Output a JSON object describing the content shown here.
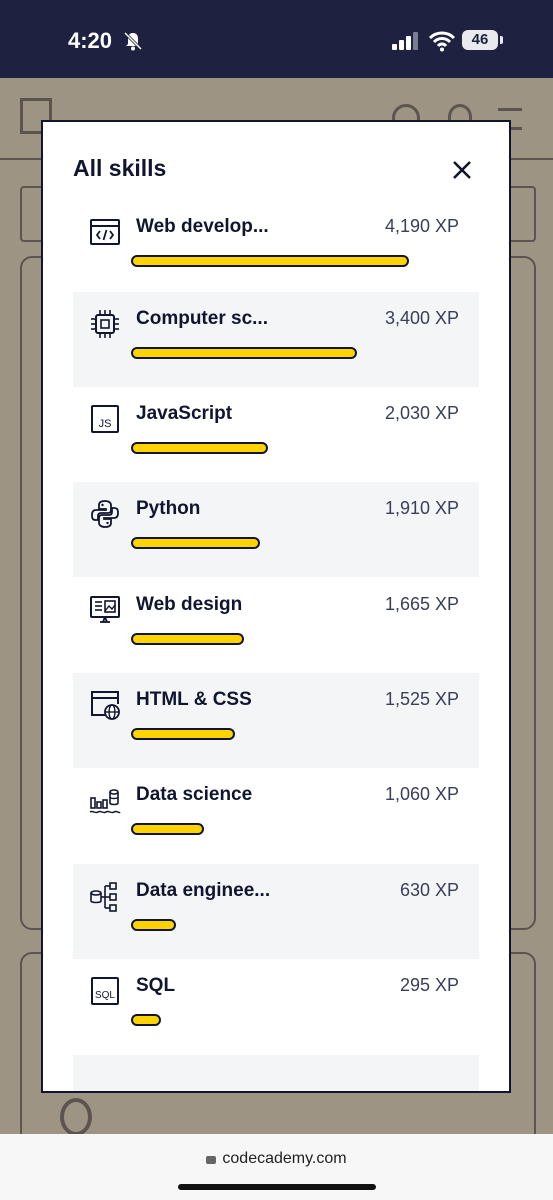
{
  "status_bar": {
    "time": "4:20",
    "battery": "46"
  },
  "modal": {
    "title": "All skills",
    "skills": [
      {
        "name": "Web develop...",
        "xp": "4,190 XP",
        "xp_value": 4190,
        "icon": "code-window-icon"
      },
      {
        "name": "Computer sc...",
        "xp": "3,400 XP",
        "xp_value": 3400,
        "icon": "chip-icon"
      },
      {
        "name": "JavaScript",
        "xp": "2,030 XP",
        "xp_value": 2030,
        "icon": "js-icon"
      },
      {
        "name": "Python",
        "xp": "1,910 XP",
        "xp_value": 1910,
        "icon": "python-icon"
      },
      {
        "name": "Web design",
        "xp": "1,665 XP",
        "xp_value": 1665,
        "icon": "web-design-icon"
      },
      {
        "name": "HTML & CSS",
        "xp": "1,525 XP",
        "xp_value": 1525,
        "icon": "html-globe-icon"
      },
      {
        "name": "Data science",
        "xp": "1,060 XP",
        "xp_value": 1060,
        "icon": "data-science-icon"
      },
      {
        "name": "Data enginee...",
        "xp": "630 XP",
        "xp_value": 630,
        "icon": "data-engineering-icon"
      },
      {
        "name": "SQL",
        "xp": "295 XP",
        "xp_value": 295,
        "icon": "sql-icon"
      }
    ]
  },
  "browser": {
    "url": "codecademy.com"
  },
  "colors": {
    "bar_fill": "#ffd300",
    "navy": "#10162f",
    "alt_row": "#f4f5f7"
  }
}
